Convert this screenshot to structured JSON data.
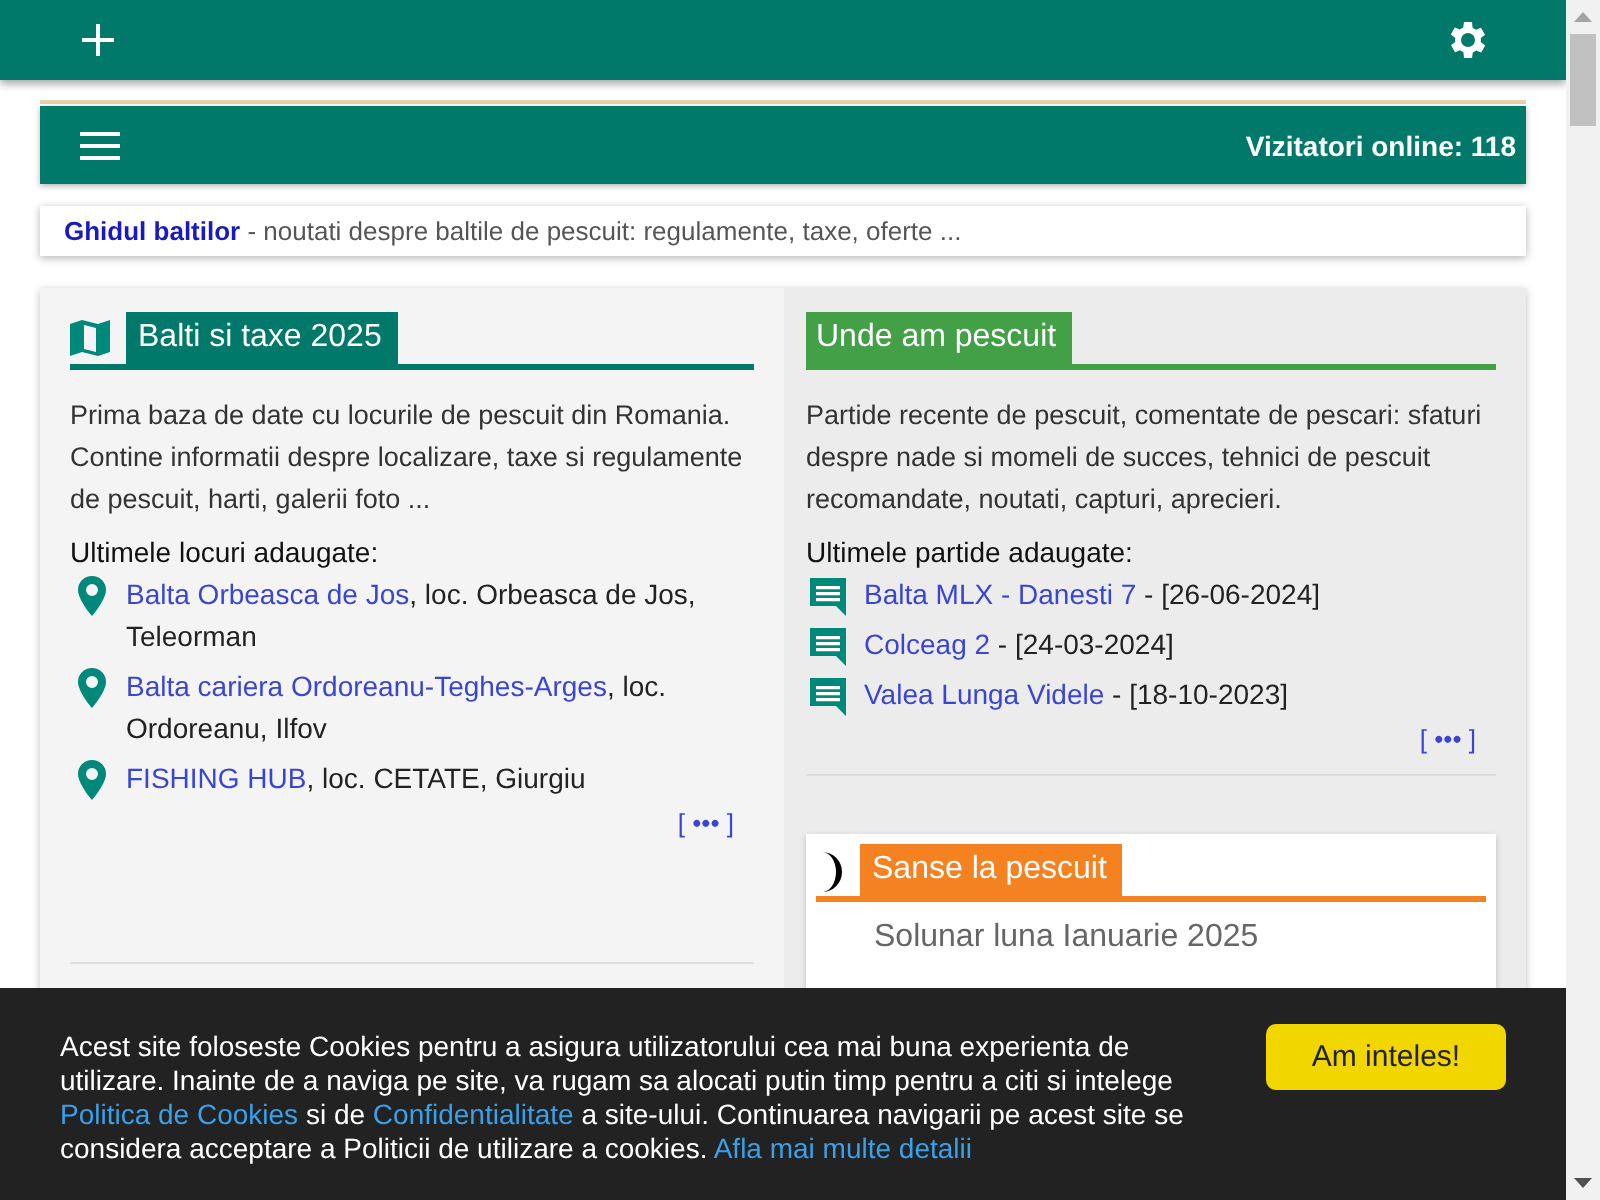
{
  "topbar": {
    "visitors": "Vizitatori online: 118"
  },
  "tagline": {
    "link": "Ghidul baltilor",
    "text": " - noutati despre baltile de pescuit: regulamente, taxe, oferte ..."
  },
  "left": {
    "title": "Balti si taxe 2025",
    "description": "Prima baza de date cu locurile de pescuit din Romania. Contine informatii despre localizare, taxe si regulamente de pescuit, harti, galerii foto ...",
    "list_title": "Ultimele locuri adaugate:",
    "items": [
      {
        "link": "Balta Orbeasca de Jos",
        "text": ", loc. Orbeasca de Jos, Teleorman"
      },
      {
        "link": "Balta cariera Ordoreanu-Teghes-Arges",
        "text": ", loc. Ordoreanu, Ilfov"
      },
      {
        "link": "FISHING HUB",
        "text": ", loc. CETATE, Giurgiu"
      }
    ],
    "more": "[ ••• ]"
  },
  "right": {
    "title": "Unde am pescuit",
    "description": "Partide recente de pescuit, comentate de pescari: sfaturi despre nade si momeli de succes, tehnici de pescuit recomandate, noutati, capturi, aprecieri.",
    "list_title": "Ultimele partide adaugate:",
    "items": [
      {
        "link": "Balta MLX - Danesti 7",
        "text": " - [26-06-2024]"
      },
      {
        "link": "Colceag 2",
        "text": " - [24-03-2024]"
      },
      {
        "link": "Valea Lunga Videle",
        "text": " - [18-10-2023]"
      }
    ],
    "more": "[ ••• ]"
  },
  "solunar": {
    "title": "Sanse la pescuit",
    "subtitle": "Solunar luna Ianuarie 2025"
  },
  "cookie": {
    "parts": [
      {
        "kind": "text",
        "text": "Acest site foloseste Cookies pentru a asigura utilizatorului cea mai buna experienta de utilizare. Inainte de a naviga pe site, va rugam sa alocati putin timp pentru a citi si intelege "
      },
      {
        "kind": "link",
        "text": "Politica de Cookies"
      },
      {
        "kind": "text",
        "text": " si de "
      },
      {
        "kind": "link",
        "text": "Confidentialitate"
      },
      {
        "kind": "text",
        "text": " a site-ului. Continuarea navigarii pe acest site se considera acceptare a Politicii de utilizare a cookies. "
      },
      {
        "kind": "link",
        "text": "Afla mai multe detalii"
      }
    ],
    "button": "Am inteles!"
  }
}
